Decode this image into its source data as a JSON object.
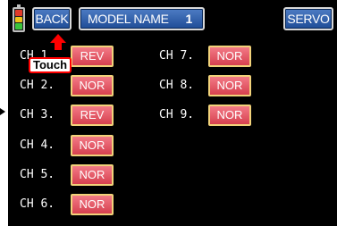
{
  "header": {
    "back_label": "BACK",
    "title": "MODEL NAME",
    "model_number": "1",
    "servo_label": "SERVO"
  },
  "battery": {
    "level_fraction": 1.0,
    "colors": [
      "#e23a2a",
      "#f0c419",
      "#3bc43b"
    ]
  },
  "annotation": {
    "touch_label": "Touch"
  },
  "channels": [
    {
      "label": "CH 1.",
      "mode": "REV"
    },
    {
      "label": "CH 2.",
      "mode": "NOR"
    },
    {
      "label": "CH 3.",
      "mode": "REV"
    },
    {
      "label": "CH 4.",
      "mode": "NOR"
    },
    {
      "label": "CH 5.",
      "mode": "NOR"
    },
    {
      "label": "CH 6.",
      "mode": "NOR"
    },
    {
      "label": "CH 7.",
      "mode": "NOR"
    },
    {
      "label": "CH 8.",
      "mode": "NOR"
    },
    {
      "label": "CH 9.",
      "mode": "NOR"
    }
  ],
  "colors": {
    "background": "#000000",
    "header_button": "#2a5aa8",
    "mode_button": "#e25a68",
    "mode_border": "#f1d27a",
    "annotation": "#ff0000"
  }
}
